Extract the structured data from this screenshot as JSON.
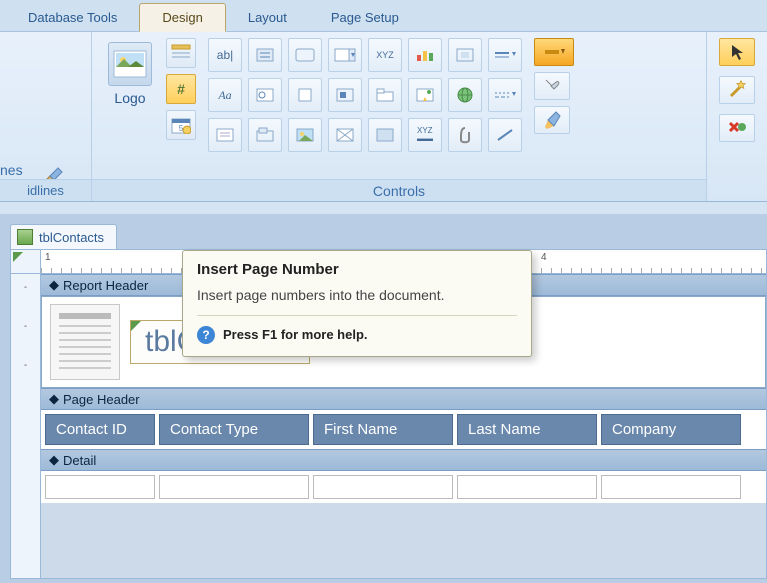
{
  "tabs": {
    "database_tools": "Database Tools",
    "design": "Design",
    "layout": "Layout",
    "page_setup": "Page Setup",
    "active": "design"
  },
  "ribbon": {
    "left_partial_top": "nes",
    "left_title": "idlines",
    "logo_label": "Logo",
    "controls_title": "Controls",
    "icons": {
      "r1": [
        "textbox-ab",
        "label",
        "button",
        "combobox",
        "listbox-xyz",
        "chart",
        "attachment-rect",
        "line-style",
        "minus",
        "arrow-cursor"
      ],
      "r2": [
        "font-aa",
        "option-button",
        "checkbox",
        "toggle",
        "page",
        "subform",
        "hyperlink",
        "date",
        "frame",
        "tools"
      ],
      "r3": [
        "textbox-small",
        "option-group",
        "image",
        "bound-frame",
        "rectangle",
        "listbox2",
        "clip",
        "line",
        "pencil",
        "cancel-x"
      ]
    },
    "pagenumber_icon": "#"
  },
  "document": {
    "tab_label": "tblContacts",
    "report_header_label": "Report Header",
    "title_field": "tblContacts",
    "page_header_label": "Page Header",
    "columns": [
      "Contact ID",
      "Contact Type",
      "First Name",
      "Last Name",
      "Company"
    ],
    "detail_label": "Detail"
  },
  "tooltip": {
    "title": "Insert Page Number",
    "body": "Insert page numbers into the document.",
    "help": "Press F1 for more help."
  }
}
